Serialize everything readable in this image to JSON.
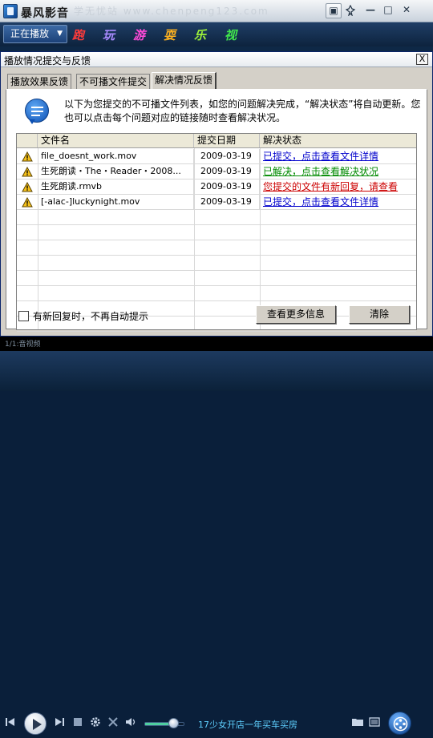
{
  "app": {
    "title": "暴风影音",
    "watermark": "学无忧站 www.chenpeng123.com",
    "title_buttons": [
      "▣",
      "📌",
      "—",
      "□",
      "✕"
    ]
  },
  "menubar": {
    "now_playing_label": "正在播放",
    "tabs": [
      {
        "label": "跑",
        "color": "#ff3b3b"
      },
      {
        "label": "玩",
        "color": "#a98bff"
      },
      {
        "label": "游",
        "color": "#ff4ad8"
      },
      {
        "label": "耍",
        "color": "#ffb21f"
      },
      {
        "label": "乐",
        "color": "#9df23a"
      },
      {
        "label": "视",
        "color": "#41e84c"
      }
    ]
  },
  "dialog": {
    "title": "播放情况提交与反馈",
    "close_label": "X",
    "tabs": [
      "播放效果反馈",
      "不可播文件提交",
      "解决情况反馈"
    ],
    "selected_tab": 2,
    "info_text": "以下为您提交的不可播文件列表，如您的问题解决完成，“解决状态”将自动更新。您也可以点击每个问题对应的链接随时查看解决状况。",
    "table": {
      "headers": [
        "文件名",
        "提交日期",
        "解决状态"
      ],
      "rows": [
        {
          "file": "file_doesnt_work.mov",
          "date": "2009-03-19",
          "status": "已提交，点击查看文件详情",
          "status_color": "#0000cc"
        },
        {
          "file": "生死朗读・The・Reader・2008...",
          "date": "2009-03-19",
          "status": "已解决，点击查看解决状况",
          "status_color": "#008a00"
        },
        {
          "file": "生死朗读.rmvb",
          "date": "2009-03-19",
          "status": "您提交的文件有新回复，请查看",
          "status_color": "#cc0000"
        },
        {
          "file": "[-alac-]luckynight.mov",
          "date": "2009-03-19",
          "status": "已提交，点击查看文件详情",
          "status_color": "#0000cc"
        }
      ]
    },
    "checkbox_label": "有新回复时，不再自动提示",
    "more_button": "查看更多信息",
    "clear_button": "清除"
  },
  "player": {
    "status_text": "1/1:音视频",
    "volume_fraction": 0.75,
    "track_text": "17少女开店一年买车买房"
  }
}
